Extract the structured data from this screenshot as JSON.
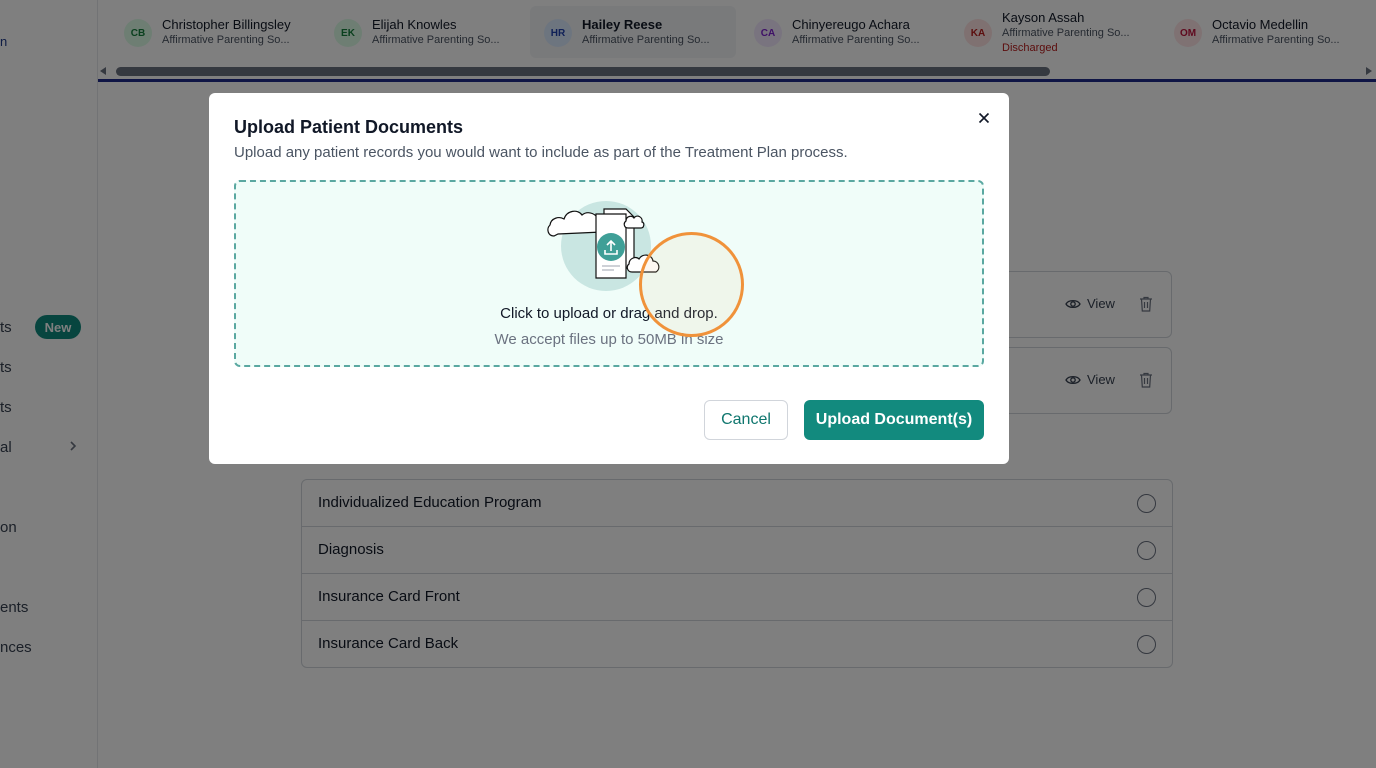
{
  "sidebar": {
    "items": [
      {
        "label": "ts",
        "badge": "New"
      },
      {
        "label": "ts"
      },
      {
        "label": "ts"
      },
      {
        "label": "al",
        "chevron": "chevron-right-icon"
      },
      {
        "label": "on"
      },
      {
        "label": "ents"
      },
      {
        "label": "nces"
      }
    ]
  },
  "tabs": [
    {
      "initials": "CB",
      "name": "Christopher Billingsley",
      "org": "Affirmative Parenting So...",
      "avatar_bg": "#dcfce7",
      "avatar_fg": "#15803d"
    },
    {
      "initials": "EK",
      "name": "Elijah Knowles",
      "org": "Affirmative Parenting So...",
      "avatar_bg": "#dcfce7",
      "avatar_fg": "#15803d"
    },
    {
      "initials": "HR",
      "name": "Hailey Reese",
      "org": "Affirmative Parenting So...",
      "avatar_bg": "#dbeafe",
      "avatar_fg": "#1e40af",
      "active": true
    },
    {
      "initials": "CA",
      "name": "Chinyereugo Achara",
      "org": "Affirmative Parenting So...",
      "avatar_bg": "#f3e8ff",
      "avatar_fg": "#7e22ce"
    },
    {
      "initials": "KA",
      "name": "Kayson Assah",
      "org": "Affirmative Parenting So...",
      "status": "Discharged",
      "avatar_bg": "#fee2e2",
      "avatar_fg": "#b91c1c"
    },
    {
      "initials": "OM",
      "name": "Octavio Medellin",
      "org": "Affirmative Parenting So...",
      "avatar_bg": "#ffe4e6",
      "avatar_fg": "#be123c"
    }
  ],
  "documents": [
    {
      "view_label": "View"
    },
    {
      "view_label": "View"
    }
  ],
  "required_docs": [
    {
      "label": "Individualized Education Program"
    },
    {
      "label": "Diagnosis"
    },
    {
      "label": "Insurance Card Front"
    },
    {
      "label": "Insurance Card Back"
    }
  ],
  "modal": {
    "title": "Upload Patient Documents",
    "subtitle": "Upload any patient records you would want to include as part of the Treatment Plan process.",
    "dropzone_main": "Click to upload or drag and drop.",
    "dropzone_sub": "We accept files up to 50MB in size",
    "cancel_label": "Cancel",
    "upload_label": "Upload Document(s)"
  },
  "colors": {
    "accent": "#128a7e",
    "nav_line": "#1e2a8a",
    "click_marker": "#f0923a"
  }
}
